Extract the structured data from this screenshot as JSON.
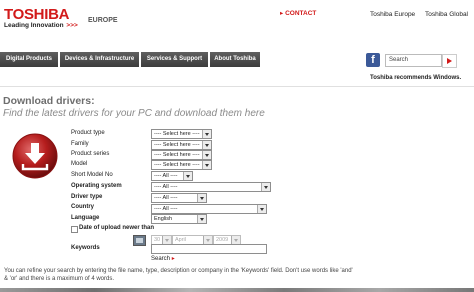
{
  "header": {
    "logo": "TOSHIBA",
    "tagline": "Leading Innovation",
    "tagline_arrows": ">>>",
    "region": "EUROPE",
    "contact_arrow": "▸",
    "contact": "CONTACT",
    "links": [
      "Toshiba Europe",
      "Toshiba Global"
    ]
  },
  "nav": {
    "items": [
      "Digital Products",
      "Devices & Infrastructure",
      "Services & Support",
      "About Toshiba"
    ],
    "search_placeholder": "Search",
    "recommend": "Toshiba recommends Windows."
  },
  "page": {
    "title": "Download drivers:",
    "subtitle": "Find the latest drivers for your PC and download them here"
  },
  "form": {
    "fields": [
      {
        "label": "Product type",
        "value": "---- Select here ----",
        "bold": false
      },
      {
        "label": "Family",
        "value": "---- Select here ----",
        "bold": false
      },
      {
        "label": "Product series",
        "value": "---- Select here ----",
        "bold": false
      },
      {
        "label": "Model",
        "value": "---- Select here ----",
        "bold": false
      },
      {
        "label": "Short Model No",
        "value": "---- All ----",
        "bold": false
      },
      {
        "label": "Operating system",
        "value": "---- All ----",
        "bold": true
      },
      {
        "label": "Driver type",
        "value": "---- All ----",
        "bold": true
      },
      {
        "label": "Country",
        "value": "---- All ----",
        "bold": true
      },
      {
        "label": "Language",
        "value": "English",
        "bold": true
      }
    ],
    "date_upload_label": "Date of upload newer than",
    "date_day": "30",
    "date_month": "April",
    "date_year": "2009",
    "keywords_label": "Keywords",
    "search_label": "Search",
    "search_arrow": "▸",
    "help_text": "You can refine your search by entering the file name, type, description or company in the 'Keywords' field. Don't use words like 'and' & 'or' and there is a maximum of 4 words."
  },
  "colors": {
    "brand_red": "#d21a1a",
    "nav_bg": "#4a4a4a"
  }
}
